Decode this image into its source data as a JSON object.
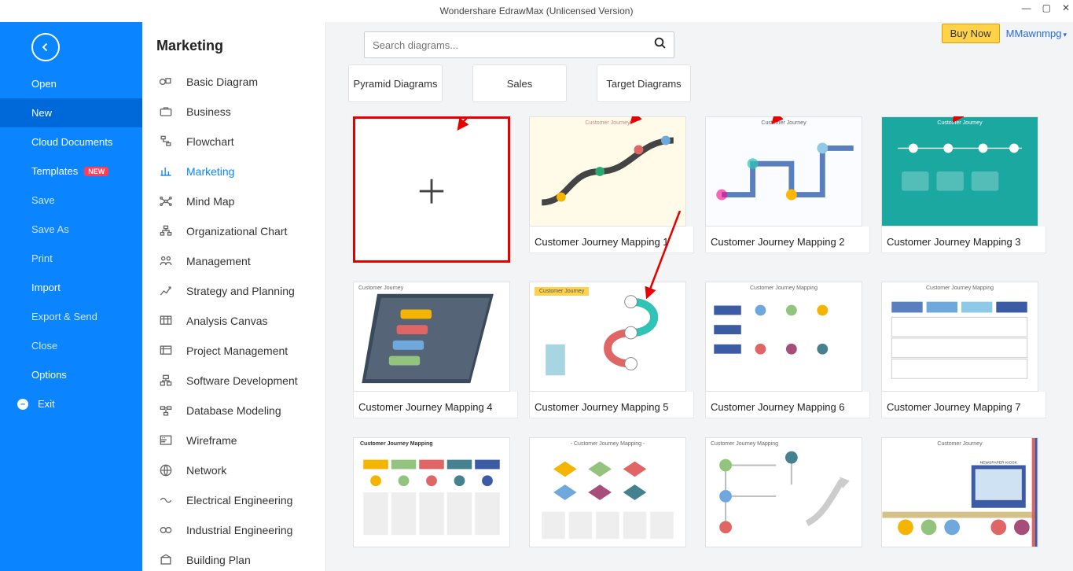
{
  "app": {
    "title": "Wondershare EdrawMax (Unlicensed Version)",
    "buy_label": "Buy Now",
    "user_label": "MMawnmpg"
  },
  "sidebar": {
    "items": [
      {
        "label": "Open",
        "dim": false
      },
      {
        "label": "New",
        "active": true
      },
      {
        "label": "Cloud Documents",
        "dim": false
      },
      {
        "label": "Templates",
        "badge": "NEW"
      },
      {
        "label": "Save",
        "dim": true
      },
      {
        "label": "Save As",
        "dim": true
      },
      {
        "label": "Print",
        "dim": true
      },
      {
        "label": "Import",
        "dim": false
      },
      {
        "label": "Export & Send",
        "dim": true
      },
      {
        "label": "Close",
        "dim": true
      },
      {
        "label": "Options",
        "dim": false
      },
      {
        "label": "Exit",
        "dim": false,
        "exit": true
      }
    ]
  },
  "categories": {
    "header": "Marketing",
    "group1": [
      {
        "label": "Basic Diagram",
        "icon": "shapes"
      },
      {
        "label": "Business",
        "icon": "briefcase"
      },
      {
        "label": "Flowchart",
        "icon": "flow"
      },
      {
        "label": "Marketing",
        "icon": "chart",
        "active": true
      },
      {
        "label": "Mind Map",
        "icon": "mindmap"
      },
      {
        "label": "Organizational Chart",
        "icon": "org"
      },
      {
        "label": "Management",
        "icon": "people"
      },
      {
        "label": "Strategy and Planning",
        "icon": "strategy"
      },
      {
        "label": "Analysis Canvas",
        "icon": "canvas"
      }
    ],
    "group2": [
      {
        "label": "Project Management",
        "icon": "project"
      },
      {
        "label": "Software Development",
        "icon": "software"
      },
      {
        "label": "Database Modeling",
        "icon": "db"
      },
      {
        "label": "Wireframe",
        "icon": "wire"
      },
      {
        "label": "Network",
        "icon": "net"
      },
      {
        "label": "Electrical Engineering",
        "icon": "elec"
      },
      {
        "label": "Industrial Engineering",
        "icon": "ind"
      },
      {
        "label": "Building Plan",
        "icon": "build"
      }
    ]
  },
  "search": {
    "placeholder": "Search diagrams..."
  },
  "chips": [
    "Pyramid Diagrams",
    "Sales",
    "Target Diagrams"
  ],
  "templates": {
    "row1": [
      {
        "blank": true
      },
      {
        "label": "Customer Journey Mapping 1",
        "style": "cj1"
      },
      {
        "label": "Customer Journey Mapping 2",
        "style": "cj2"
      },
      {
        "label": "Customer Journey Mapping 3",
        "style": "cj3"
      }
    ],
    "row2": [
      {
        "label": "Customer Journey Mapping 4",
        "style": "cj4"
      },
      {
        "label": "Customer Journey Mapping 5",
        "style": "cj5"
      },
      {
        "label": "Customer Journey Mapping 6",
        "style": "cj6"
      },
      {
        "label": "Customer Journey Mapping 7",
        "style": "cj7"
      }
    ],
    "row3": [
      {
        "label": "",
        "style": "cj8"
      },
      {
        "label": "",
        "style": "cj9"
      },
      {
        "label": "",
        "style": "cj10"
      },
      {
        "label": "",
        "style": "cj11"
      }
    ]
  }
}
